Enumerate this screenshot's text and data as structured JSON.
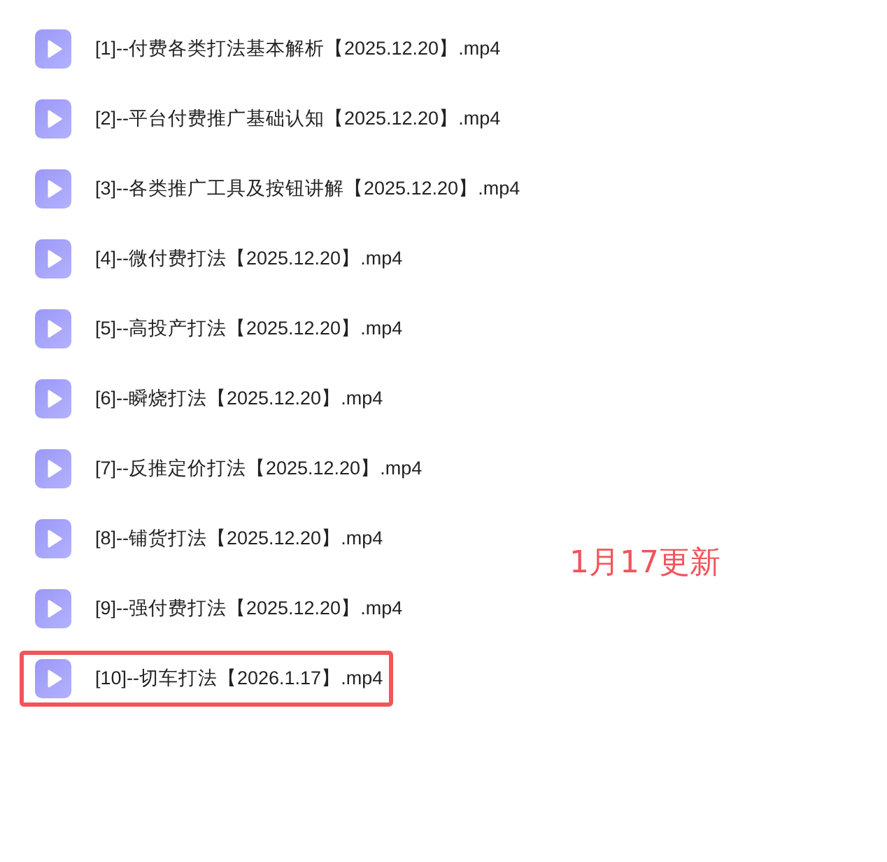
{
  "files": [
    {
      "name": "[1]--付费各类打法基本解析【2025.12.20】.mp4",
      "highlighted": false
    },
    {
      "name": "[2]--平台付费推广基础认知【2025.12.20】.mp4",
      "highlighted": false
    },
    {
      "name": "[3]--各类推广工具及按钮讲解【2025.12.20】.mp4",
      "highlighted": false
    },
    {
      "name": "[4]--微付费打法【2025.12.20】.mp4",
      "highlighted": false
    },
    {
      "name": "[5]--高投产打法【2025.12.20】.mp4",
      "highlighted": false
    },
    {
      "name": "[6]--瞬烧打法【2025.12.20】.mp4",
      "highlighted": false
    },
    {
      "name": "[7]--反推定价打法【2025.12.20】.mp4",
      "highlighted": false
    },
    {
      "name": "[8]--铺货打法【2025.12.20】.mp4",
      "highlighted": false
    },
    {
      "name": "[9]--强付费打法【2025.12.20】.mp4",
      "highlighted": false
    },
    {
      "name": "[10]--切车打法【2026.1.17】.mp4",
      "highlighted": true
    }
  ],
  "annotation": "1月17更新"
}
